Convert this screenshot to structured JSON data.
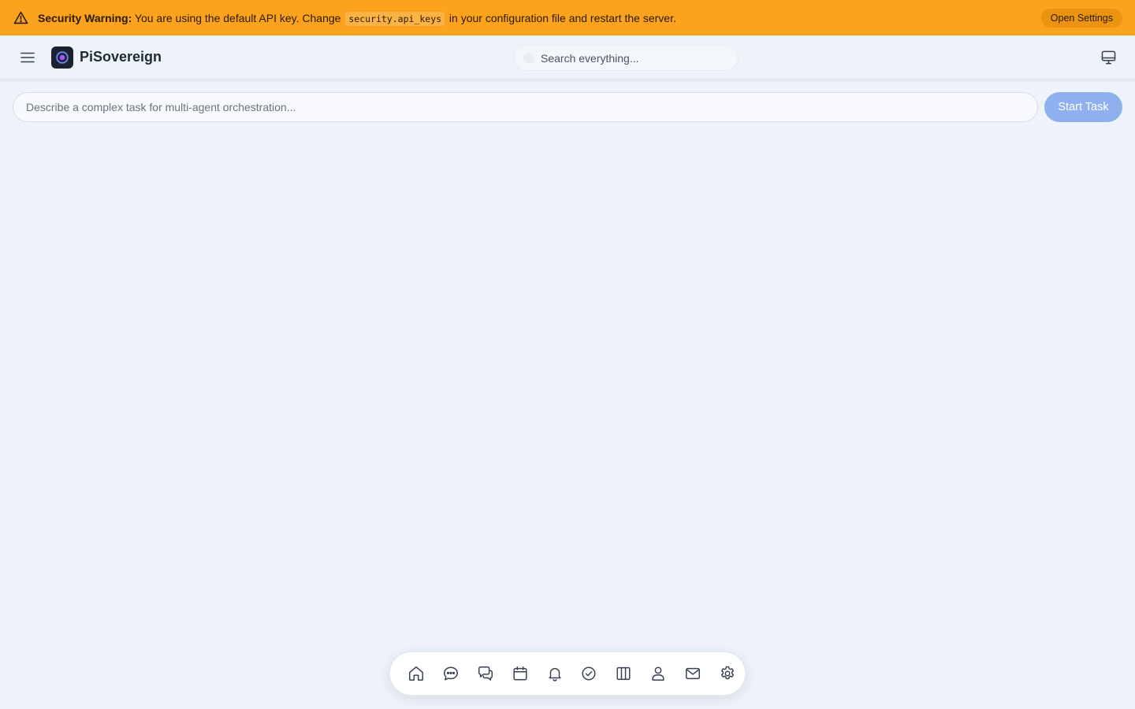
{
  "banner": {
    "strong": "Security Warning:",
    "text_before": " You are using the default API key. Change ",
    "code": "security.api_keys",
    "text_after": " in your configuration file and restart the server.",
    "button": "Open Settings",
    "color": "#fba31d"
  },
  "header": {
    "brand": "PiSovereign",
    "search_placeholder": "Search everything..."
  },
  "task": {
    "placeholder": "Describe a complex task for multi-agent orchestration...",
    "button": "Start Task",
    "button_color": "#8fb0ef"
  },
  "dock": {
    "items": [
      "home-icon",
      "chat-icon",
      "conversations-icon",
      "calendar-icon",
      "bell-icon",
      "check-circle-icon",
      "columns-icon",
      "user-icon",
      "mail-icon",
      "gear-icon"
    ]
  }
}
